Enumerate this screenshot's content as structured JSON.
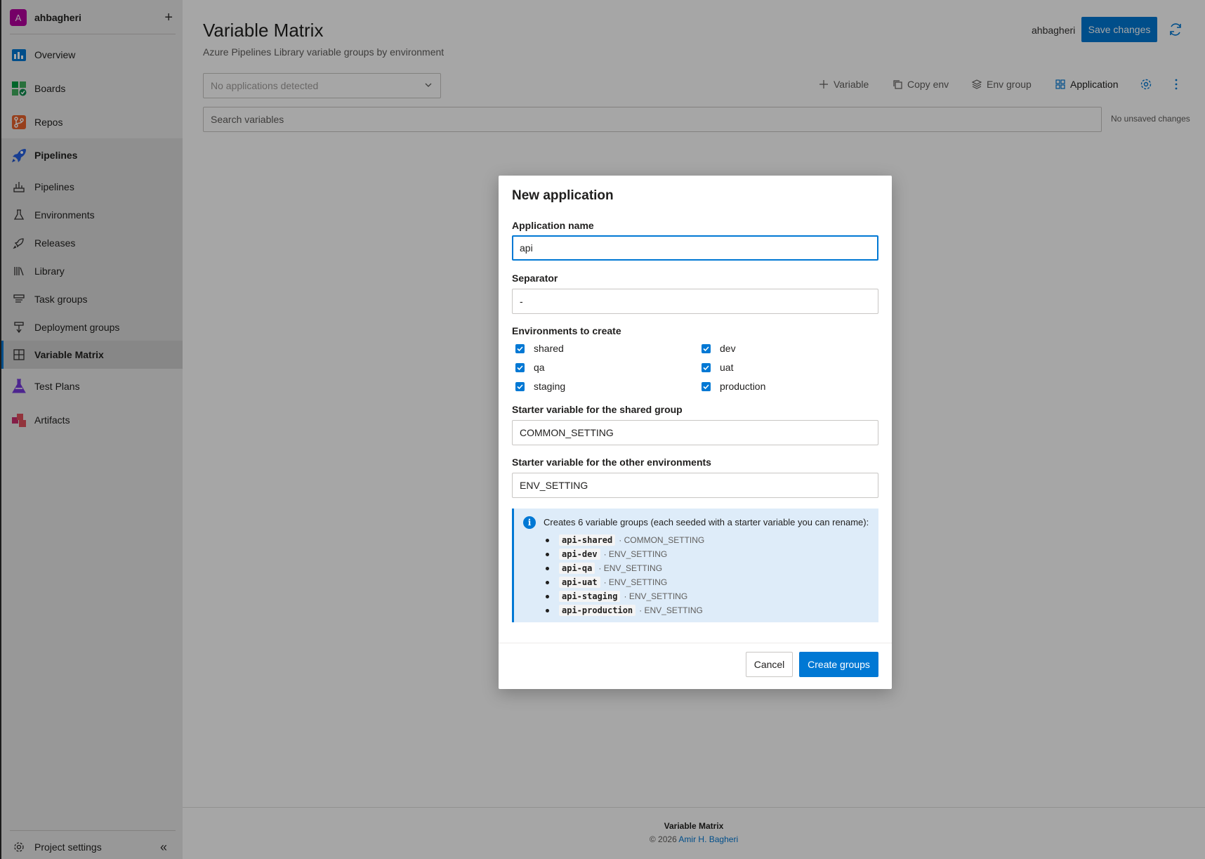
{
  "sidebar": {
    "org_initial": "A",
    "org_name": "ahbagheri",
    "items": [
      {
        "label": "Overview",
        "icon": "overview-icon"
      },
      {
        "label": "Boards",
        "icon": "boards-icon"
      },
      {
        "label": "Repos",
        "icon": "repos-icon"
      },
      {
        "label": "Pipelines",
        "icon": "pipelines-icon"
      },
      {
        "label": "Pipelines",
        "icon": "pipeline-sub-icon"
      },
      {
        "label": "Environments",
        "icon": "environments-icon"
      },
      {
        "label": "Releases",
        "icon": "releases-icon"
      },
      {
        "label": "Library",
        "icon": "library-icon"
      },
      {
        "label": "Task groups",
        "icon": "task-groups-icon"
      },
      {
        "label": "Deployment groups",
        "icon": "deployment-groups-icon"
      },
      {
        "label": "Variable Matrix",
        "icon": "grid-icon"
      },
      {
        "label": "Test Plans",
        "icon": "test-plans-icon"
      },
      {
        "label": "Artifacts",
        "icon": "artifacts-icon"
      }
    ],
    "project_settings": "Project settings"
  },
  "header": {
    "title": "Variable Matrix",
    "subtitle": "Azure Pipelines Library variable groups by environment",
    "user": "ahbagheri",
    "save_label": "Save changes"
  },
  "toolbar": {
    "app_select_value": "No applications detected",
    "variable": "Variable",
    "copy_env": "Copy env",
    "env_group": "Env group",
    "application": "Application"
  },
  "search": {
    "placeholder": "Search variables",
    "status": "No unsaved changes"
  },
  "footer": {
    "title": "Variable Matrix",
    "copyright": "© 2026",
    "author": "Amir H. Bagheri"
  },
  "dialog": {
    "title": "New application",
    "app_name_label": "Application name",
    "app_name_value": "api",
    "separator_label": "Separator",
    "separator_value": "-",
    "envs_label": "Environments to create",
    "envs": [
      {
        "name": "shared",
        "checked": true
      },
      {
        "name": "dev",
        "checked": true
      },
      {
        "name": "qa",
        "checked": true
      },
      {
        "name": "uat",
        "checked": true
      },
      {
        "name": "staging",
        "checked": true
      },
      {
        "name": "production",
        "checked": true
      }
    ],
    "shared_var_label": "Starter variable for the shared group",
    "shared_var_value": "COMMON_SETTING",
    "other_var_label": "Starter variable for the other environments",
    "other_var_value": "ENV_SETTING",
    "info_text": "Creates 6 variable groups (each seeded with a starter variable you can rename):",
    "groups": [
      {
        "name": "api-shared",
        "var": "· COMMON_SETTING"
      },
      {
        "name": "api-dev",
        "var": "· ENV_SETTING"
      },
      {
        "name": "api-qa",
        "var": "· ENV_SETTING"
      },
      {
        "name": "api-uat",
        "var": "· ENV_SETTING"
      },
      {
        "name": "api-staging",
        "var": "· ENV_SETTING"
      },
      {
        "name": "api-production",
        "var": "· ENV_SETTING"
      }
    ],
    "cancel_label": "Cancel",
    "create_label": "Create groups"
  },
  "colors": {
    "accent": "#0078d4",
    "org_avatar": "#b4009e"
  }
}
